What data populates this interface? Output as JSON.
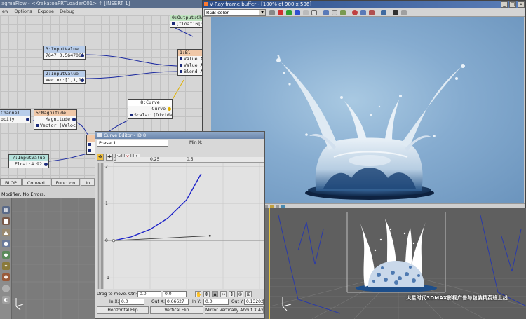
{
  "magma": {
    "title": "agmaFlow - <KrakatoaPRTLoader001> ⇑  [INSERT 1]",
    "menu": [
      "ew",
      "Options",
      "Expose",
      "Debug"
    ],
    "tabs": [
      "BLOP",
      "Convert",
      "Function",
      "In"
    ],
    "status": "Modifier, No Errors.",
    "nodes": {
      "output": {
        "header": "0:Output:Ch",
        "row1": "[float16[3]"
      },
      "blend": {
        "header": "1:Bl",
        "row1": "Value A",
        "row2": "Value A",
        "row3": "Blend A"
      },
      "input3": {
        "header": "3:InputValue",
        "row1": "7647,0.564706]"
      },
      "input2": {
        "header": "2:InputValue",
        "row1": "Vector:[1,1,1]"
      },
      "curve": {
        "header": "8:Curve",
        "row1": "Curve",
        "row2": "Scalar (Divide."
      },
      "channel": {
        "header": "Channel",
        "row1": "ocity"
      },
      "magnitude": {
        "header": "5:Magnitude",
        "row1": "Magnitude",
        "row2": "Vector (Veloci"
      },
      "input7": {
        "header": "7:InputValue",
        "row1": "Float:4.92"
      }
    }
  },
  "curve_editor": {
    "title": "Curve Editor - ID 8",
    "preset": "Preset1",
    "min_label": "Min X:",
    "ruler_ticks": [
      "0",
      "0.25",
      "0.5"
    ],
    "y_labels": [
      "2",
      "1",
      "0",
      "-1"
    ],
    "drag_hint": "Drag to move. Ctrl+clk",
    "field_a": "0.0",
    "field_b": "0.0",
    "in_x_label": "In X:",
    "in_x": "0.0",
    "out_x_label": "Out X:",
    "out_x": "0.66627",
    "in_y_label": "In Y:",
    "in_y": "0.0",
    "out_y_label": "Out Y:",
    "out_y": "0.13202",
    "buttons": {
      "hflip": "Horizontal Flip",
      "vflip": "Vertical Flip",
      "mirror": "Mirror Vertically About X Axis"
    },
    "chart_data": {
      "type": "line",
      "xlabel": "",
      "ylabel": "",
      "ylim": [
        -1.3,
        2.1
      ],
      "series": [
        {
          "x": [
            0,
            0.12,
            0.25,
            0.37,
            0.5,
            0.6
          ],
          "values": [
            0,
            0.1,
            0.3,
            0.6,
            1.1,
            1.8
          ]
        },
        {
          "x": [
            0,
            0.66
          ],
          "values": [
            0,
            0.13
          ]
        }
      ]
    }
  },
  "vfb": {
    "title": "V-Ray frame buffer - [100% of 900 x 506]",
    "channel": "RGB color",
    "colors": {
      "background": "#86acd0",
      "liquid": "#dfeaf3",
      "base": "#1c3d63"
    }
  },
  "viewport": {
    "watermark": "火星时代3DMAX影视广告与包装精英班上线"
  }
}
